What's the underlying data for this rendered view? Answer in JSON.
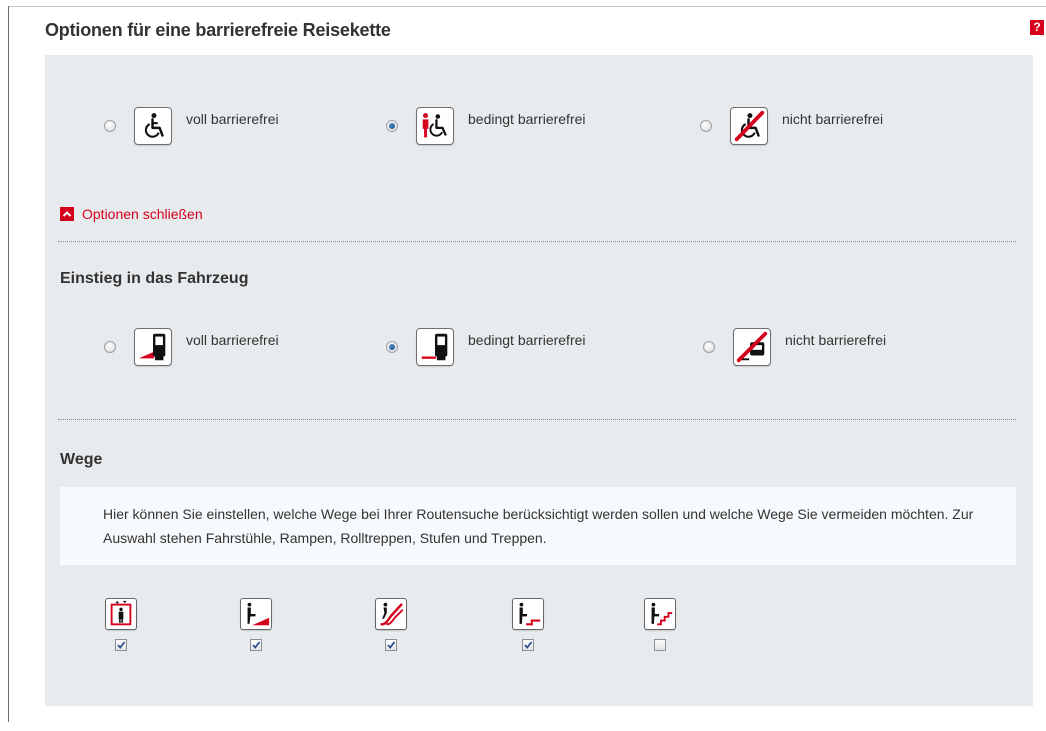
{
  "title": "Optionen für eine barrierefreie Reisekette",
  "help_label": "?",
  "chain_options": [
    {
      "label": "voll barrierefrei",
      "icon": "wheelchair-icon",
      "selected": false
    },
    {
      "label": "bedingt barrierefrei",
      "icon": "wheelchair-assistance-icon",
      "selected": true
    },
    {
      "label": "nicht barrierefrei",
      "icon": "wheelchair-crossed-icon",
      "selected": false
    }
  ],
  "toggle_label": "Optionen schließen",
  "entry": {
    "heading": "Einstieg in das Fahrzeug",
    "options": [
      {
        "label": "voll barrierefrei",
        "icon": "ramp-bus-icon",
        "selected": false
      },
      {
        "label": "bedingt barrierefrei",
        "icon": "step-bus-icon",
        "selected": true
      },
      {
        "label": "nicht barrierefrei",
        "icon": "bus-crossed-icon",
        "selected": false
      }
    ]
  },
  "ways": {
    "heading": "Wege",
    "info": "Hier können Sie einstellen, welche Wege bei Ihrer Routensuche berücksichtigt werden sollen und welche Wege Sie vermeiden möchten. Zur Auswahl stehen Fahrstühle, Rampen, Rolltreppen, Stufen und Treppen.",
    "items": [
      {
        "icon": "elevator-icon",
        "checked": true
      },
      {
        "icon": "ramp-icon",
        "checked": true
      },
      {
        "icon": "escalator-icon",
        "checked": true
      },
      {
        "icon": "step-icon",
        "checked": true
      },
      {
        "icon": "stairs-icon",
        "checked": false
      }
    ]
  },
  "colors": {
    "accent": "#d5001c",
    "panel": "#e8ebed",
    "info_bg": "#f7fafc",
    "radio_selected": "#1f4f88"
  }
}
